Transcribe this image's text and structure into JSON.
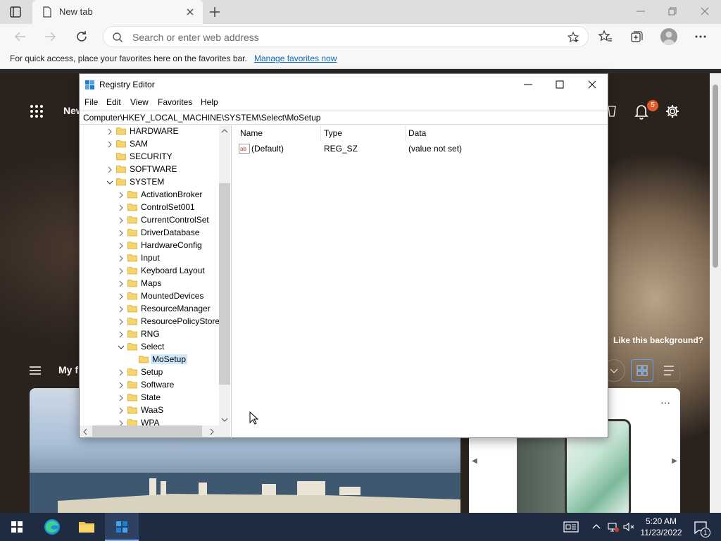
{
  "browser": {
    "tab_title": "New tab",
    "address_placeholder": "Search or enter web address",
    "favorites_bar_message": "For quick access, place your favorites here on the favorites bar.",
    "favorites_bar_link": "Manage favorites now"
  },
  "new_tab_page": {
    "title": "New",
    "notification_count": "5",
    "background_prompt": "Like this background?",
    "feed_title": "My f",
    "card_more": "···"
  },
  "registry": {
    "window_title": "Registry Editor",
    "menu": [
      "File",
      "Edit",
      "View",
      "Favorites",
      "Help"
    ],
    "address_path": "Computer\\HKEY_LOCAL_MACHINE\\SYSTEM\\Select\\MoSetup",
    "tree": [
      {
        "label": "HARDWARE",
        "level": 0,
        "state": "collapsed"
      },
      {
        "label": "SAM",
        "level": 0,
        "state": "collapsed"
      },
      {
        "label": "SECURITY",
        "level": 0,
        "state": "none"
      },
      {
        "label": "SOFTWARE",
        "level": 0,
        "state": "collapsed"
      },
      {
        "label": "SYSTEM",
        "level": 0,
        "state": "expanded"
      },
      {
        "label": "ActivationBroker",
        "level": 1,
        "state": "collapsed"
      },
      {
        "label": "ControlSet001",
        "level": 1,
        "state": "collapsed"
      },
      {
        "label": "CurrentControlSet",
        "level": 1,
        "state": "collapsed"
      },
      {
        "label": "DriverDatabase",
        "level": 1,
        "state": "collapsed"
      },
      {
        "label": "HardwareConfig",
        "level": 1,
        "state": "collapsed"
      },
      {
        "label": "Input",
        "level": 1,
        "state": "collapsed"
      },
      {
        "label": "Keyboard Layout",
        "level": 1,
        "state": "collapsed"
      },
      {
        "label": "Maps",
        "level": 1,
        "state": "collapsed"
      },
      {
        "label": "MountedDevices",
        "level": 1,
        "state": "collapsed"
      },
      {
        "label": "ResourceManager",
        "level": 1,
        "state": "collapsed"
      },
      {
        "label": "ResourcePolicyStore",
        "level": 1,
        "state": "collapsed"
      },
      {
        "label": "RNG",
        "level": 1,
        "state": "collapsed"
      },
      {
        "label": "Select",
        "level": 1,
        "state": "expanded"
      },
      {
        "label": "MoSetup",
        "level": 2,
        "state": "none",
        "selected": true
      },
      {
        "label": "Setup",
        "level": 1,
        "state": "collapsed"
      },
      {
        "label": "Software",
        "level": 1,
        "state": "collapsed"
      },
      {
        "label": "State",
        "level": 1,
        "state": "collapsed"
      },
      {
        "label": "WaaS",
        "level": 1,
        "state": "collapsed"
      },
      {
        "label": "WPA",
        "level": 1,
        "state": "collapsed"
      }
    ],
    "columns": [
      "Name",
      "Type",
      "Data"
    ],
    "values": [
      {
        "name": "(Default)",
        "type": "REG_SZ",
        "data": "(value not set)"
      }
    ]
  },
  "taskbar": {
    "time": "5:20 AM",
    "date": "11/23/2022",
    "notification_count": "1"
  },
  "colors": {
    "accent_link": "#0f6cbd",
    "selection": "#cce8ff",
    "taskbar": "#1e2b40",
    "notification_badge": "#e15a2c"
  }
}
